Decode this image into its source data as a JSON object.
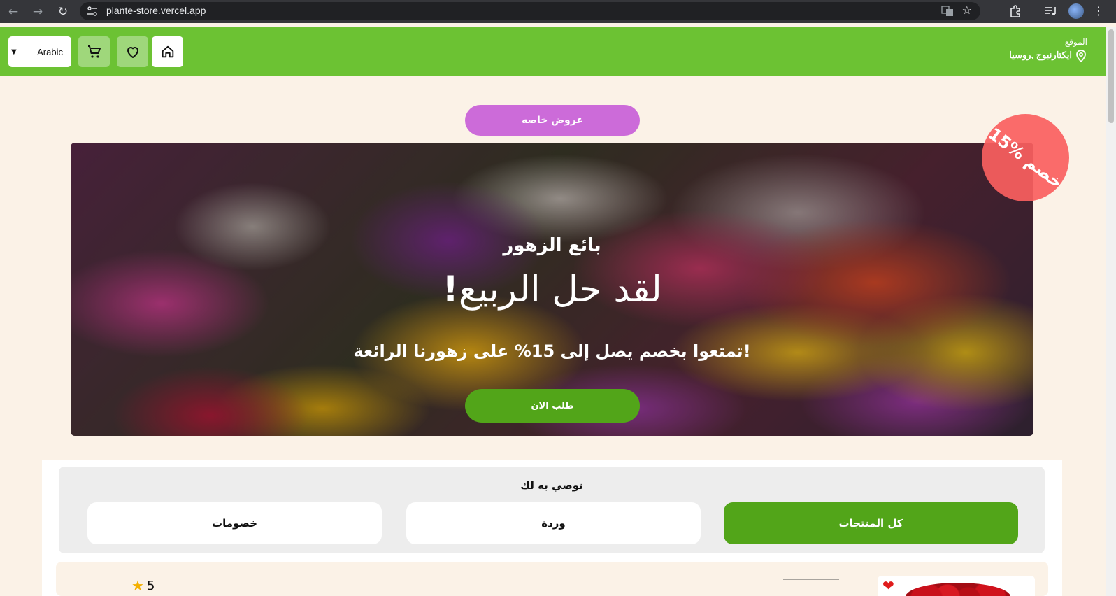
{
  "browser": {
    "url": "plante-store.vercel.app"
  },
  "header": {
    "language": "Arabic",
    "location_label": "الموقع",
    "location_value": "ايكتارنبوج ,روسيا"
  },
  "offers_button": "عروض خاصه",
  "hero": {
    "florist": "بائع الزهور",
    "spring_text": "لقد حل الربيع",
    "spring_mark": "!",
    "promo": "تمتعوا بخصم يصل إلى 15% على زهورنا الرائعة!",
    "order_button": "طلب الان",
    "discount_badge": "15% خصم"
  },
  "recommend": {
    "title": "نوصي به لك",
    "tabs": [
      {
        "label": "كل المنتجات",
        "active": true
      },
      {
        "label": "وردة",
        "active": false
      },
      {
        "label": "خصومات",
        "active": false
      }
    ]
  },
  "product": {
    "rating": "5"
  },
  "colors": {
    "header_green": "#6cc233",
    "accent_green": "#52a519",
    "offers_purple": "#cc6bd9",
    "badge_red": "#fa6060",
    "page_bg": "#fbf2e7"
  },
  "icons": [
    "back-icon",
    "forward-icon",
    "reload-icon",
    "site-info-icon",
    "translate-icon",
    "bookmark-star-icon",
    "extensions-icon",
    "media-icon",
    "profile-icon",
    "menu-icon",
    "chevron-down-icon",
    "cart-icon",
    "heart-icon",
    "home-icon",
    "location-pin-icon",
    "star-icon"
  ]
}
